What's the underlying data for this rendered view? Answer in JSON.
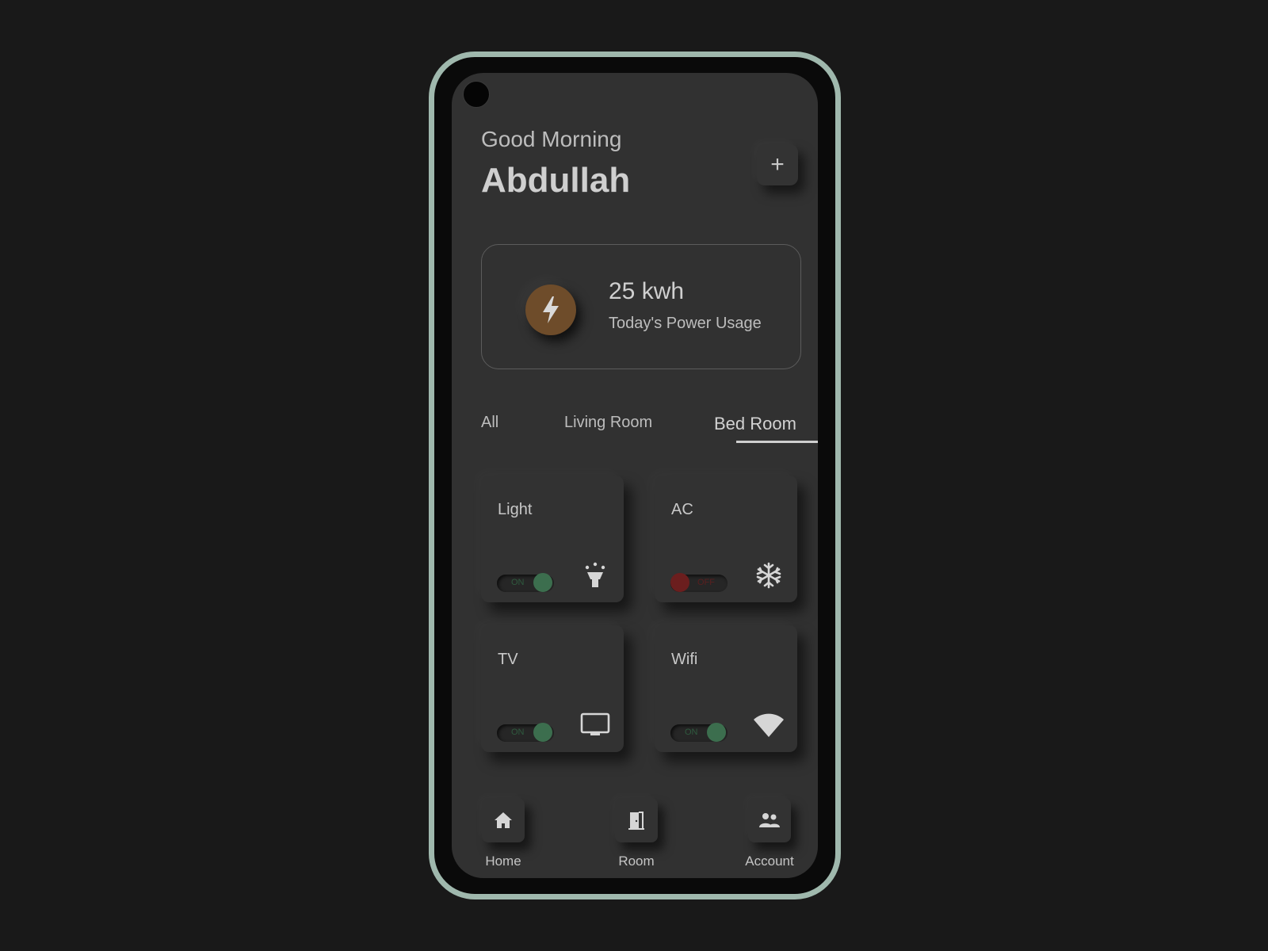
{
  "header": {
    "greeting": "Good Morning",
    "username": "Abdullah",
    "add_label": "+"
  },
  "power": {
    "value": "25 kwh",
    "label": "Today's Power Usage",
    "icon": "lightning-bolt-icon",
    "accent_color": "#6e4c2a"
  },
  "tabs": [
    {
      "label": "All",
      "active": false
    },
    {
      "label": "Living Room",
      "active": false
    },
    {
      "label": "Bed Room",
      "active": true
    }
  ],
  "devices": [
    {
      "name": "Light",
      "state": "ON",
      "on": true,
      "icon": "lamp-icon"
    },
    {
      "name": "AC",
      "state": "OFF",
      "on": false,
      "icon": "snowflake-icon"
    },
    {
      "name": "TV",
      "state": "ON",
      "on": true,
      "icon": "tv-icon"
    },
    {
      "name": "Wifi",
      "state": "ON",
      "on": true,
      "icon": "wifi-icon"
    }
  ],
  "nav": [
    {
      "label": "Home",
      "icon": "home-icon"
    },
    {
      "label": "Room",
      "icon": "door-icon"
    },
    {
      "label": "Account",
      "icon": "people-icon"
    }
  ],
  "colors": {
    "frame": "#9fb8ad",
    "screen_bg": "#313131",
    "toggle_on": "#3c6e4e",
    "toggle_off": "#6b1e1e"
  }
}
